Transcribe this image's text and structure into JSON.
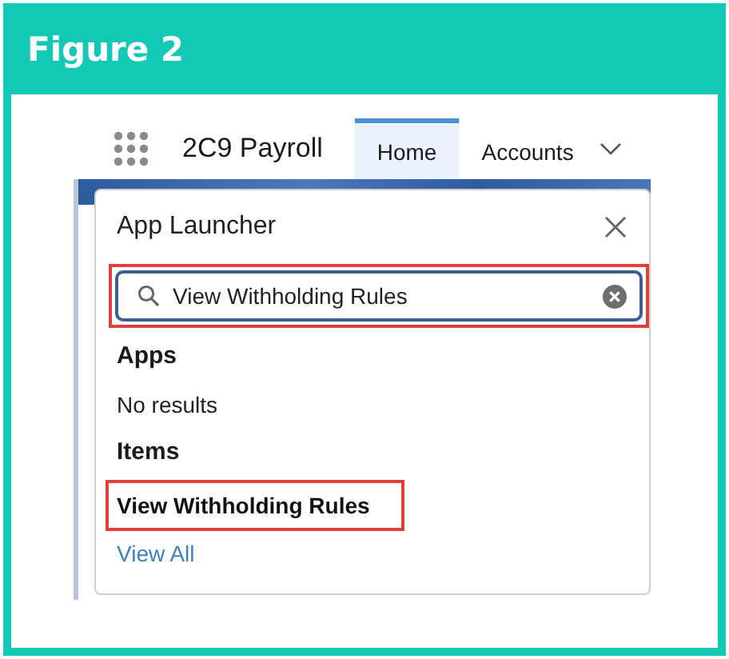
{
  "figure": {
    "title": "Figure 2"
  },
  "app_nav": {
    "app_name": "2C9 Payroll",
    "tabs": [
      {
        "label": "Home",
        "selected": true
      },
      {
        "label": "Accounts",
        "selected": false
      }
    ]
  },
  "launcher": {
    "title": "App Launcher",
    "search": {
      "value": "View Withholding Rules",
      "highlighted": true
    },
    "sections": [
      {
        "heading": "Apps",
        "empty_text": "No results"
      },
      {
        "heading": "Items",
        "items": [
          {
            "label": "View Withholding Rules",
            "highlighted": true
          }
        ]
      }
    ],
    "view_all": "View All"
  }
}
